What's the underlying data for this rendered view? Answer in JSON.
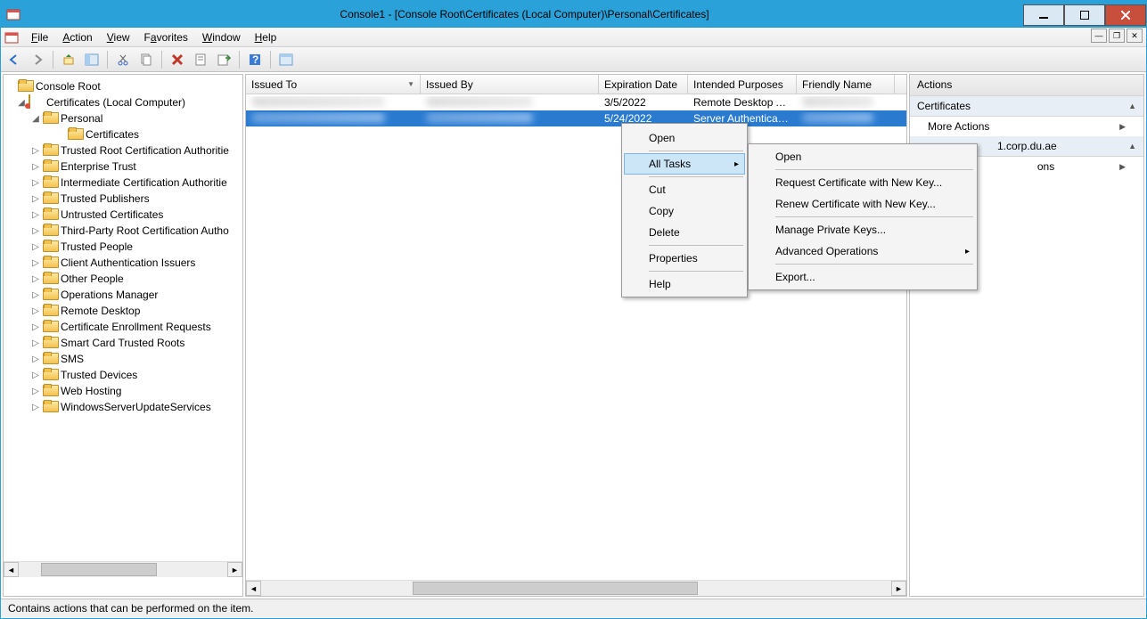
{
  "window": {
    "title": "Console1 - [Console Root\\Certificates (Local Computer)\\Personal\\Certificates]"
  },
  "menu": {
    "file": "File",
    "action": "Action",
    "view": "View",
    "favorites": "Favorites",
    "window": "Window",
    "help": "Help"
  },
  "tree": {
    "root": "Console Root",
    "certs": "Certificates (Local Computer)",
    "personal": "Personal",
    "certificates": "Certificates",
    "nodes": [
      "Trusted Root Certification Authoritie",
      "Enterprise Trust",
      "Intermediate Certification Authoritie",
      "Trusted Publishers",
      "Untrusted Certificates",
      "Third-Party Root Certification Autho",
      "Trusted People",
      "Client Authentication Issuers",
      "Other People",
      "Operations Manager",
      "Remote Desktop",
      "Certificate Enrollment Requests",
      "Smart Card Trusted Roots",
      "SMS",
      "Trusted Devices",
      "Web Hosting",
      "WindowsServerUpdateServices"
    ]
  },
  "columns": {
    "issued_to": "Issued To",
    "issued_by": "Issued By",
    "exp": "Expiration Date",
    "purpose": "Intended Purposes",
    "fname": "Friendly Name"
  },
  "rows": [
    {
      "exp": "3/5/2022",
      "purpose": "Remote Desktop A...",
      "selected": false
    },
    {
      "exp": "5/24/2022",
      "purpose": "Server Authenticati...",
      "selected": true
    }
  ],
  "context1": {
    "open": "Open",
    "alltasks": "All Tasks",
    "cut": "Cut",
    "copy": "Copy",
    "delete": "Delete",
    "properties": "Properties",
    "help": "Help"
  },
  "context2": {
    "open": "Open",
    "req": "Request Certificate with New Key...",
    "renew": "Renew Certificate with New Key...",
    "mpk": "Manage Private Keys...",
    "adv": "Advanced Operations",
    "export": "Export..."
  },
  "actions": {
    "header": "Actions",
    "sec1": "Certificates",
    "more": "More Actions",
    "sec2_suffix": "1.corp.du.ae",
    "more2_partial": "ons"
  },
  "status": "Contains actions that can be performed on the item."
}
